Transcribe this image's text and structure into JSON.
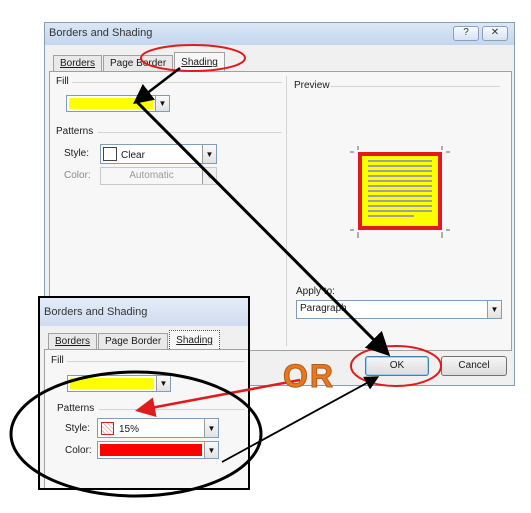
{
  "main_dialog": {
    "title": "Borders and Shading",
    "help_icon": "?",
    "close_icon": "✕",
    "tabs": [
      {
        "label": "Borders",
        "active": false
      },
      {
        "label": "Page Border",
        "active": false
      },
      {
        "label": "Shading",
        "active": true
      }
    ],
    "fill_label": "Fill",
    "fill_color": "#ffff00",
    "patterns_label": "Patterns",
    "style_label": "Style:",
    "style_value": "Clear",
    "color_label": "Color:",
    "color_value": "Automatic",
    "preview_label": "Preview",
    "apply_to_label": "Apply to:",
    "apply_to_value": "Paragraph",
    "ok_label": "OK",
    "cancel_label": "Cancel"
  },
  "inset_dialog": {
    "title": "Borders and Shading",
    "tabs": [
      {
        "label": "Borders",
        "active": false
      },
      {
        "label": "Page Border",
        "active": false
      },
      {
        "label": "Shading",
        "active": true
      }
    ],
    "fill_label": "Fill",
    "fill_color": "#ffff00",
    "patterns_label": "Patterns",
    "style_label": "Style:",
    "style_value": "15%",
    "color_label": "Color:",
    "color_value_color": "#ff0000"
  },
  "annotation": {
    "or_text": "OR",
    "or_color": "#e87722",
    "arrow_color_black": "#000000",
    "arrow_color_red": "#e01b1b",
    "highlight_color": "#e01b1b"
  },
  "colors": {
    "preview_border": "#e01b1b",
    "preview_fill": "#ffff00",
    "preview_lines": "#a0a0a0"
  }
}
